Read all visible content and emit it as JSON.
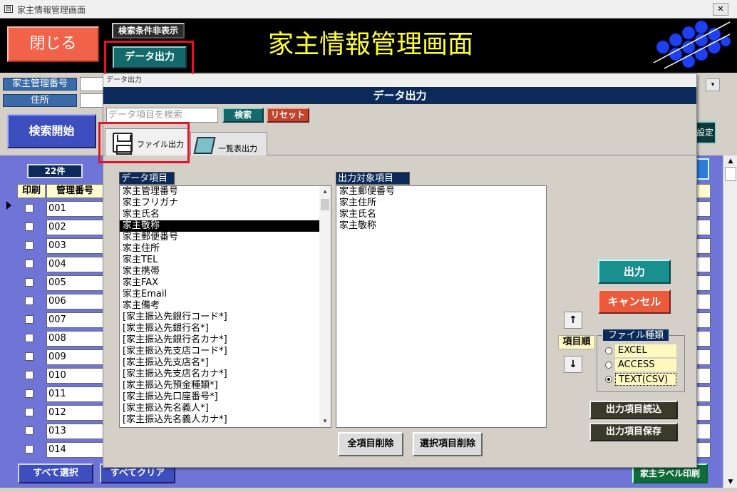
{
  "window": {
    "title": "家主情報管理画面",
    "close_glyph": "✕",
    "app_icon_glyph": "目"
  },
  "header": {
    "close_label": "閉じる",
    "hide_search_label": "検索条件非表示",
    "export_label": "データ出力",
    "title": "家主情報管理画面"
  },
  "filters": {
    "owner_id_label": "家主管理番号",
    "address_label": "住所",
    "dropdown_glyph": "▾"
  },
  "search": {
    "start_label": "検索開始",
    "set_label": "設定"
  },
  "grid": {
    "count": "22件",
    "col_print": "印刷",
    "col_id": "管理番号",
    "rows": [
      "001",
      "002",
      "003",
      "004",
      "005",
      "006",
      "007",
      "008",
      "009",
      "010",
      "011",
      "012",
      "013",
      "014"
    ],
    "select_all": "すべて選択",
    "clear_all": "すべてクリア",
    "label_print": "家主ラベル印刷"
  },
  "dialog": {
    "window_title": "データ出力",
    "heading": "データ出力",
    "search_placeholder": "データ項目を検索",
    "search_btn": "検索",
    "reset_btn": "リセット",
    "tab_file": "ファイル出力",
    "tab_list": "一覧表出力",
    "data_items_header": "データ項目",
    "data_items": [
      "家主管理番号",
      "家主フリガナ",
      "家主氏名",
      "家主敬称",
      "家主郵便番号",
      "家主住所",
      "家主TEL",
      "家主携帯",
      "家主FAX",
      "家主Email",
      "家主備考",
      "[家主振込先銀行コード*]",
      "[家主振込先銀行名*]",
      "[家主振込先銀行名カナ*]",
      "[家主振込先支店コード*]",
      "[家主振込先支店名*]",
      "[家主振込先支店名カナ*]",
      "[家主振込先預金種類*]",
      "[家主振込先口座番号*]",
      "[家主振込先名義人*]",
      "[家主振込先名義人カナ*]"
    ],
    "selected_index": 3,
    "output_items_header": "出力対象項目",
    "output_items": [
      "家主郵便番号",
      "家主住所",
      "家主氏名",
      "家主敬称"
    ],
    "output_btn": "出力",
    "cancel_btn": "キャンセル",
    "up_glyph": "↑",
    "down_glyph": "↓",
    "order_label": "項目順",
    "file_type_label": "ファイル種類",
    "file_types": [
      "EXCEL",
      "ACCESS",
      "TEXT(CSV)"
    ],
    "file_type_selected": "TEXT(CSV)",
    "load_items_btn": "出力項目読込",
    "save_items_btn": "出力項目保存",
    "delete_all_btn": "全項目削除",
    "delete_selected_btn": "選択項目削除",
    "scroll_up_glyph": "▲",
    "scroll_down_glyph": "▼"
  }
}
